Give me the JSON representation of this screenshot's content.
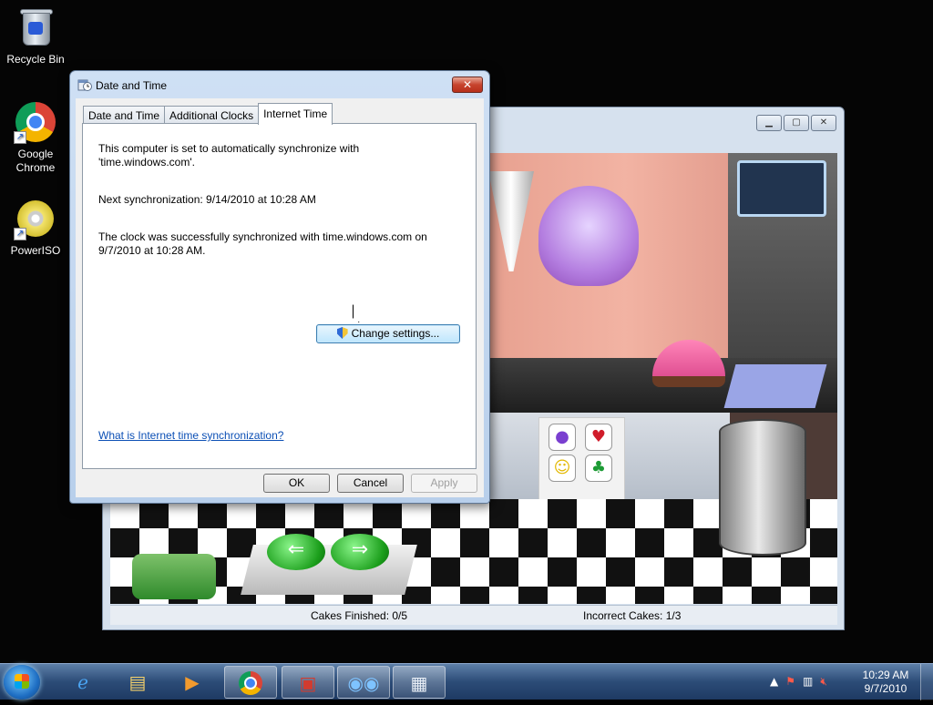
{
  "desktop": {
    "icons": [
      {
        "label": "Recycle Bin",
        "icon": "recycle-bin-icon"
      },
      {
        "label": "Google Chrome",
        "icon": "chrome-icon"
      },
      {
        "label": "PowerISO",
        "icon": "poweriso-icon"
      }
    ]
  },
  "game_window": {
    "status": {
      "cakes_finished": "Cakes Finished: 0/5",
      "incorrect_cakes": "Incorrect Cakes: 1/3"
    }
  },
  "dialog": {
    "title": "Date and Time",
    "close_label": "✕",
    "tabs": [
      {
        "label": "Date and Time",
        "active": false
      },
      {
        "label": "Additional Clocks",
        "active": false
      },
      {
        "label": "Internet Time",
        "active": true
      }
    ],
    "sync_text": "This computer is set to automatically synchronize with 'time.windows.com'.",
    "next_sync": "Next synchronization: 9/14/2010 at 10:28 AM",
    "last_sync": "The clock was successfully synchronized with time.windows.com on 9/7/2010 at 10:28 AM.",
    "change_settings": "Change settings...",
    "help_link": "What is Internet time synchronization?",
    "buttons": {
      "ok": "OK",
      "cancel": "Cancel",
      "apply": "Apply"
    }
  },
  "taskbar": {
    "clock_time": "10:29 AM",
    "clock_date": "9/7/2010"
  }
}
